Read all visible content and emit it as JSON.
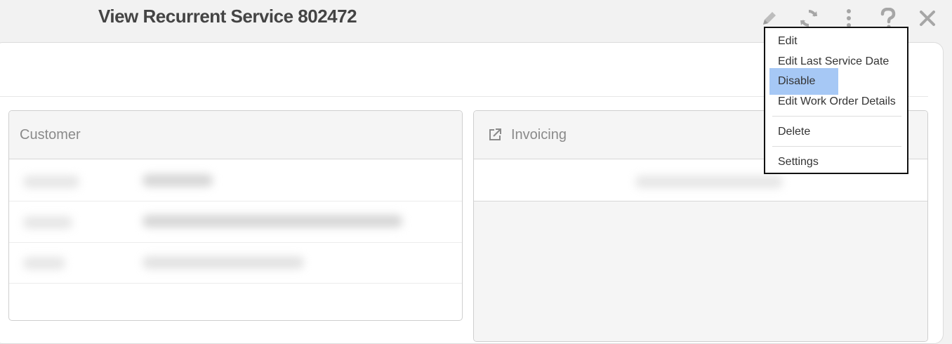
{
  "header": {
    "title": "View Recurrent Service 802472"
  },
  "toolbar": {
    "icons": [
      "pencil-icon",
      "refresh-icon",
      "more-vertical-icon",
      "help-icon",
      "close-icon"
    ]
  },
  "panels": {
    "customer": {
      "title": "Customer"
    },
    "invoicing": {
      "title": "Invoicing",
      "icon": "external-link-icon"
    }
  },
  "menu": {
    "items": [
      {
        "label": "Edit"
      },
      {
        "label": "Edit Last Service Date"
      },
      {
        "label": "Disable",
        "selected": true
      },
      {
        "label": "Edit Work Order Details"
      },
      {
        "label": "Delete"
      },
      {
        "label": "Settings"
      }
    ],
    "highlight_color": "#a6c8f5"
  }
}
